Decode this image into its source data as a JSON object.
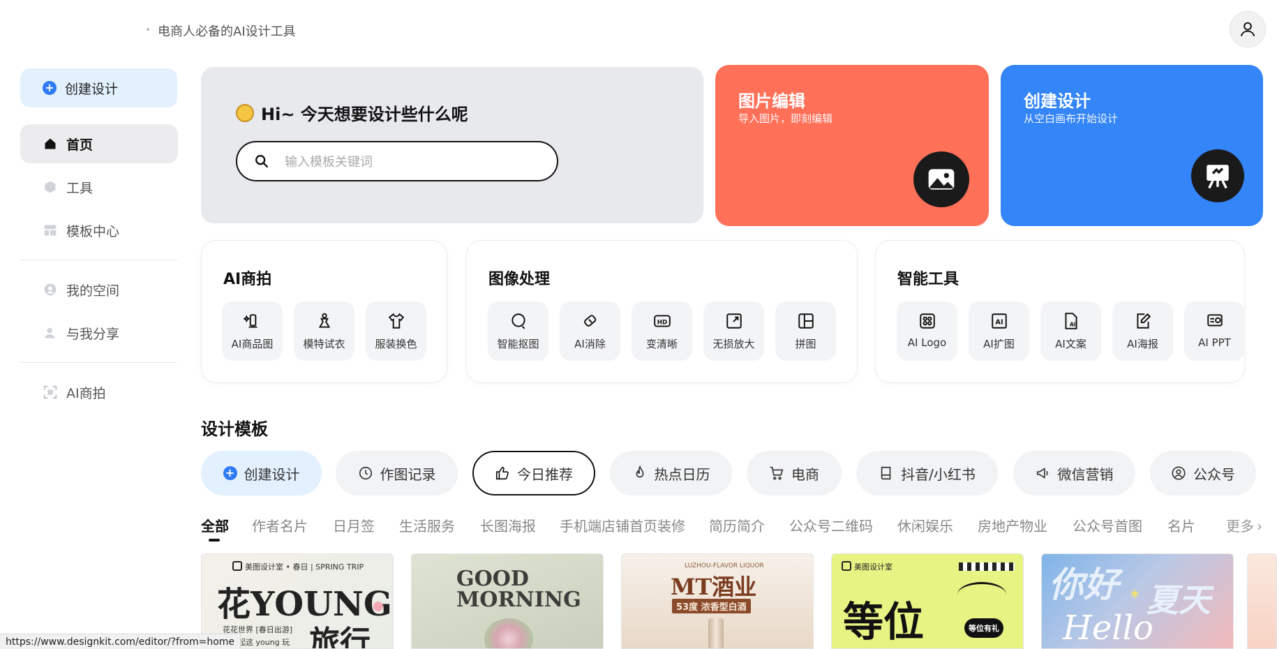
{
  "header": {
    "tagline": "电商人必备的AI设计工具"
  },
  "sidebar": {
    "create": "创建设计",
    "items": [
      {
        "label": "首页",
        "icon": "home-icon"
      },
      {
        "label": "工具",
        "icon": "cube-icon"
      },
      {
        "label": "模板中心",
        "icon": "template-icon"
      },
      {
        "label": "我的空间",
        "icon": "user-circle-icon"
      },
      {
        "label": "与我分享",
        "icon": "share-user-icon"
      },
      {
        "label": "AI商拍",
        "icon": "ai-shoot-icon"
      }
    ]
  },
  "hero": {
    "greeting": "Hi~ 今天想要设计些什么呢",
    "search_placeholder": "输入模板关键词",
    "edit_card": {
      "title": "图片编辑",
      "subtitle": "导入图片，即刻编辑",
      "color": "#ff7059"
    },
    "create_card": {
      "title": "创建设计",
      "subtitle": "从空白画布开始设计",
      "color": "#3385f8"
    }
  },
  "tool_groups": [
    {
      "title": "AI商拍",
      "items": [
        "AI商品图",
        "模特试衣",
        "服装换色"
      ]
    },
    {
      "title": "图像处理",
      "items": [
        "智能抠图",
        "AI消除",
        "变清晰",
        "无损放大",
        "拼图"
      ]
    },
    {
      "title": "智能工具",
      "items": [
        "AI Logo",
        "AI扩图",
        "AI文案",
        "AI海报",
        "AI PPT"
      ]
    }
  ],
  "templates": {
    "title": "设计模板",
    "chips": [
      "创建设计",
      "作图记录",
      "今日推荐",
      "热点日历",
      "电商",
      "抖音/小红书",
      "微信营销",
      "公众号"
    ],
    "categories": [
      "全部",
      "作者名片",
      "日月签",
      "生活服务",
      "长图海报",
      "手机端店铺首页装修",
      "简历简介",
      "公众号二维码",
      "休闲娱乐",
      "房地产物业",
      "公众号首图",
      "名片",
      "更多"
    ],
    "thumbs": [
      {
        "brand": "美图设计室 • 春日 | SPRING TRIP",
        "main": "花YOUNG",
        "sub": "旅行",
        "note": "花花世界 [春日出游]",
        "note2": "我一起这 young 玩"
      },
      {
        "main": "GOOD",
        "sub": "MORNING"
      },
      {
        "brand": "LUZHOU-FLAVOR LIQUOR",
        "main": "MT酒业",
        "sub": "53度 浓香型白酒"
      },
      {
        "brand": "美图设计室",
        "main": "等位",
        "sub": "等位有礼"
      },
      {
        "main": "你好",
        "sub": "夏天",
        "note": "Hello"
      }
    ]
  },
  "status_url": "https://www.designkit.com/editor/?from=home"
}
